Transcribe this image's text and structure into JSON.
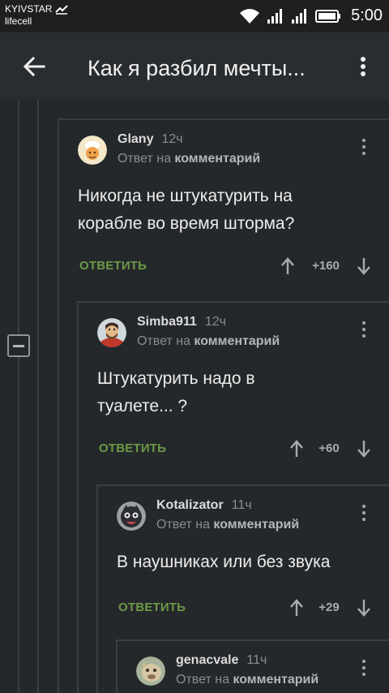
{
  "status_bar": {
    "carrier_1": "KYIVSTAR",
    "carrier_2": "lifecell",
    "time": "5:00"
  },
  "app_bar": {
    "title": "Как я разбил мечты..."
  },
  "comments": [
    {
      "author": "Glany",
      "time": "12ч",
      "reply_prefix": "Ответ на",
      "reply_target": "комментарий",
      "text_line_1": "Никогда не штукатурить на",
      "text_line_2": "корабле во время шторма?",
      "reply_label": "ОТВЕТИТЬ",
      "score": "+160"
    },
    {
      "author": "Simba911",
      "time": "12ч",
      "reply_prefix": "Ответ на",
      "reply_target": "комментарий",
      "text_line_1": "Штукатурить надо в",
      "text_line_2": "туалете... ?",
      "reply_label": "ОТВЕТИТЬ",
      "score": "+60"
    },
    {
      "author": "Kotalizator",
      "time": "11ч",
      "reply_prefix": "Ответ на",
      "reply_target": "комментарий",
      "text_line_1": "В наушниках или без звука",
      "reply_label": "ОТВЕТИТЬ",
      "score": "+29"
    },
    {
      "author": "genacvale",
      "time": "11ч",
      "reply_prefix": "Ответ на",
      "reply_target": "комментарий"
    }
  ],
  "colors": {
    "background": "#25282b",
    "app_bar": "#2a2d30",
    "reply_action": "#6b9a46",
    "thread_line": "#3a3d41"
  },
  "icons": {
    "back": "arrow-left-icon",
    "more": "more-vertical-icon",
    "upvote": "arrow-up-icon",
    "downvote": "arrow-down-icon",
    "collapse": "collapse-minus-icon"
  }
}
